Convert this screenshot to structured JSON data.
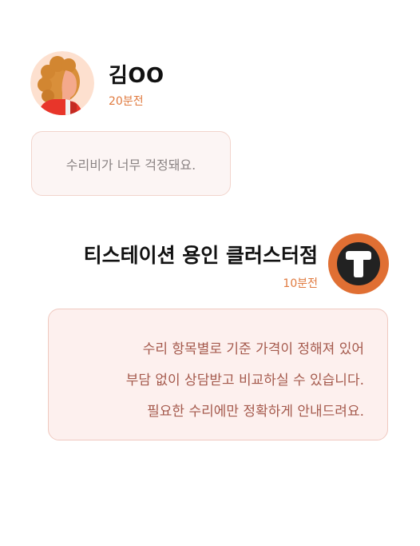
{
  "user_message": {
    "avatar_icon": "woman-avatar-icon",
    "name": "김OO",
    "time": "20분전",
    "text": "수리비가 너무 걱정돼요."
  },
  "store_reply": {
    "avatar_icon": "t-logo-icon",
    "name": "티스테이션 용인 클러스터점",
    "time": "10분전",
    "lines": [
      "수리 항목별로 기준 가격이 정해져 있어",
      "부담 없이 상담받고 비교하실 수 있습니다.",
      "필요한 수리에만 정확하게 안내드려요."
    ]
  },
  "colors": {
    "accent": "#e07a3f",
    "user_bubble_bg": "#fcf5f4",
    "user_bubble_border": "#f2d4cc",
    "store_bubble_bg": "#fdf0ee",
    "store_bubble_border": "#f0c9c0",
    "store_text": "#a55a4d",
    "user_text": "#8a8383",
    "logo_orange": "#e06f33",
    "logo_dark": "#222222"
  }
}
